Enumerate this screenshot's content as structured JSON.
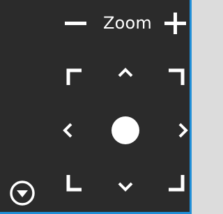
{
  "zoom": {
    "label": "Zoom",
    "decrease_icon": "minus-icon",
    "increase_icon": "plus-icon"
  },
  "pan_controls": {
    "corner_icons": [
      "corner-top-left-icon",
      "corner-top-right-icon",
      "corner-bottom-left-icon",
      "corner-bottom-right-icon"
    ],
    "arrow_icons": [
      "chevron-up-icon",
      "chevron-down-icon",
      "chevron-left-icon",
      "chevron-right-icon"
    ],
    "center_icon": "center-dot-icon"
  },
  "collapse_icon": "chevron-down-circle-icon",
  "colors": {
    "panel_background": "#2b2b2b",
    "foreground": "#ffffff",
    "accent_border": "#1f8fd8"
  }
}
